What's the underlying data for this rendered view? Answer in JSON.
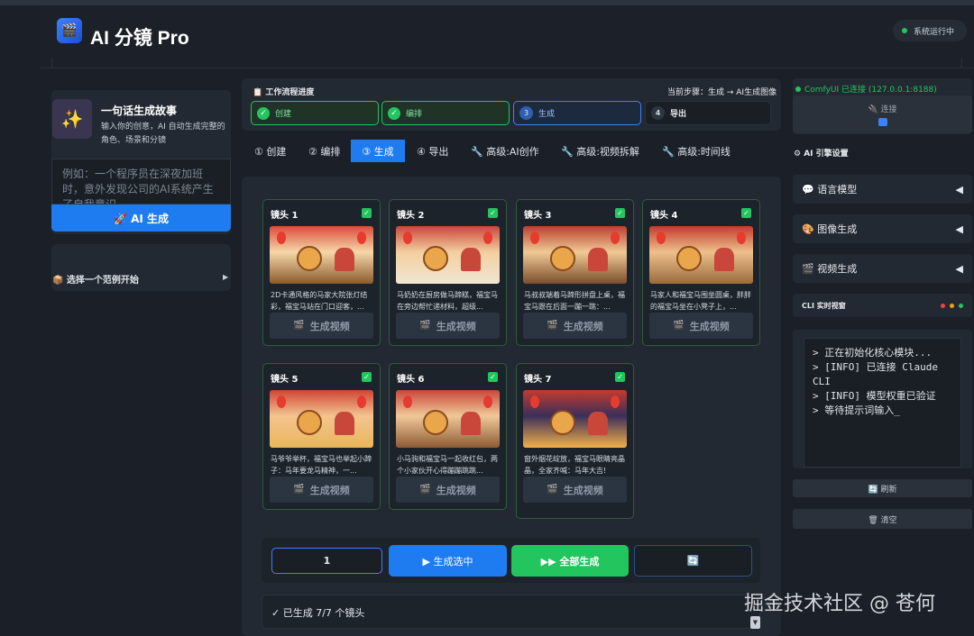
{
  "header": {
    "app_title": "AI 分镜 Pro",
    "status": "系统运行中",
    "logo_icon": "clapperboard-icon"
  },
  "story": {
    "icon": "sparkles-icon",
    "title": "一句话生成故事",
    "description": "输入你的创意，AI 自动生成完整的角色、场景和分镜",
    "placeholder": "例如：一个程序员在深夜加班时，意外发现公司的AI系统产生了自我意识...",
    "generate_label": "🚀 AI 生成",
    "examples_label": "📦 选择一个范例开始",
    "examples_arrow": "▶"
  },
  "workflow": {
    "title": "📋 工作流程进度",
    "current_step": "当前步骤：生成 → AI生成图像",
    "steps": [
      {
        "label": "创建",
        "state": "done"
      },
      {
        "label": "编排",
        "state": "done"
      },
      {
        "num": "3",
        "label": "生成",
        "state": "active"
      },
      {
        "num": "4",
        "label": "导出",
        "state": "todo"
      }
    ]
  },
  "tabs": [
    {
      "label": "① 创建"
    },
    {
      "label": "② 编排"
    },
    {
      "label": "③ 生成",
      "active": true
    },
    {
      "label": "④ 导出"
    },
    {
      "label": "🔧 高级:AI创作"
    },
    {
      "label": "🔧 高级:视频拆解"
    },
    {
      "label": "🔧 高级:时间线"
    }
  ],
  "shots": [
    {
      "name": "镜头 1",
      "desc": "2D卡通风格的马家大院张灯结彩，福宝马站在门口迎客，...",
      "button": "生成视频"
    },
    {
      "name": "镜头 2",
      "desc": "马奶奶在厨房做马蹄糕，福宝马在旁边帮忙递材料，超级...",
      "button": "生成视频"
    },
    {
      "name": "镜头 3",
      "desc": "马叔叔端着马蹄形拼盘上桌，福宝马跟在后面一蹦一跳：...",
      "button": "生成视频"
    },
    {
      "name": "镜头 4",
      "desc": "马家人和福宝马围坐圆桌，胖胖的福宝马坐在小凳子上，...",
      "button": "生成视频"
    },
    {
      "name": "镜头 5",
      "desc": "马爷爷举杯，福宝马也举起小蹄子：马年要龙马精神，一...",
      "button": "生成视频"
    },
    {
      "name": "镜头 6",
      "desc": "小马驹和福宝马一起收红包，两个小家伙开心得蹦蹦跳跳...",
      "button": "生成视频"
    },
    {
      "name": "镜头 7",
      "desc": "窗外烟花绽放，福宝马眼睛亮晶晶，全家齐喊：马年大吉!",
      "button": "生成视频"
    }
  ],
  "controls": {
    "count_value": "1",
    "generate_selected": "▶ 生成选中",
    "generate_all": "▶▶ 全部生成",
    "refresh_icon": "refresh-icon",
    "refresh_glyph": "🔄"
  },
  "status_text": "✓ 已生成 7/7 个镜头",
  "right_panel": {
    "comfy_status": "ComfyUI 已连接 (127.0.0.1:8188)",
    "connect_label": "🔌 连接",
    "engine_title": "⚙ AI 引擎设置",
    "engines": [
      {
        "label": "💬 语言模型",
        "arrow": "◀"
      },
      {
        "label": "🎨 图像生成",
        "arrow": "◀"
      },
      {
        "label": "🎬 视频生成",
        "arrow": "◀"
      }
    ],
    "cli_title": "CLI 实时视窗",
    "cli_lines": [
      "> 正在初始化核心模块...",
      "> [INFO] 已连接 Claude CLI",
      "> [INFO] 模型权重已验证",
      "> 等待提示词输入_"
    ],
    "cli_refresh": "🔄 刷新",
    "cli_clear": "🗑 清空"
  },
  "watermark": "掘金技术社区 @ 苍何",
  "colors": {
    "accent_blue": "#1e7cf0",
    "success_green": "#22c55e",
    "background": "#1b2028",
    "panel": "#232932"
  }
}
